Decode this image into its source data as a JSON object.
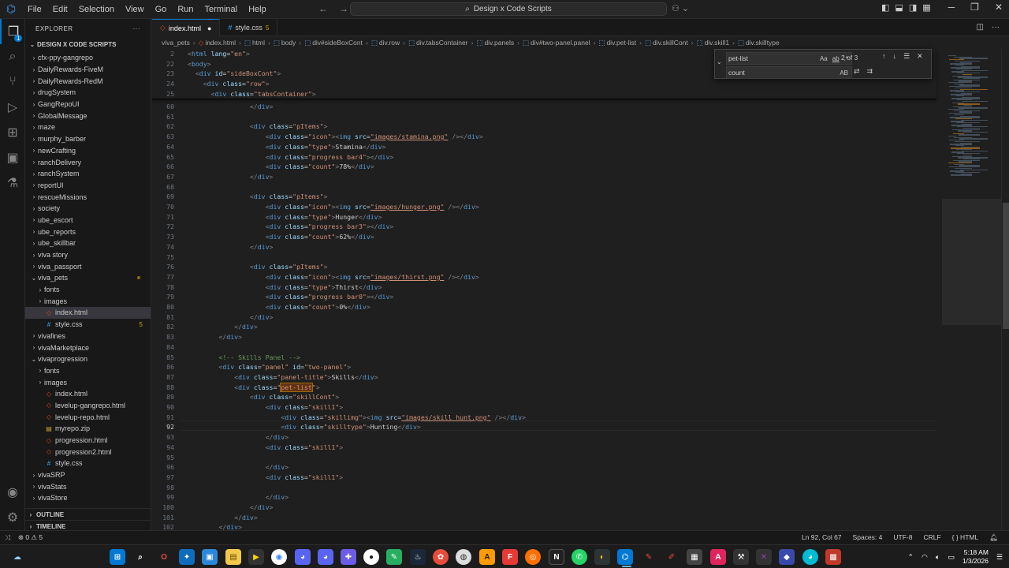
{
  "menu": [
    "File",
    "Edit",
    "Selection",
    "View",
    "Go",
    "Run",
    "Terminal",
    "Help"
  ],
  "command_center": "Design x Code Scripts",
  "explorer": {
    "header": "EXPLORER",
    "project": "DESIGN X CODE SCRIPTS",
    "items": [
      {
        "label": "cfx-ppy-gangrepo",
        "type": "folder",
        "indent": 1
      },
      {
        "label": "DailyRewards-FiveM",
        "type": "folder",
        "indent": 1
      },
      {
        "label": "DailyRewards-RedM",
        "type": "folder",
        "indent": 1
      },
      {
        "label": "drugSystem",
        "type": "folder",
        "indent": 1
      },
      {
        "label": "GangRepoUI",
        "type": "folder",
        "indent": 1
      },
      {
        "label": "GlobalMessage",
        "type": "folder",
        "indent": 1
      },
      {
        "label": "maze",
        "type": "folder",
        "indent": 1
      },
      {
        "label": "murphy_barber",
        "type": "folder",
        "indent": 1
      },
      {
        "label": "newCrafting",
        "type": "folder",
        "indent": 1
      },
      {
        "label": "ranchDelivery",
        "type": "folder",
        "indent": 1
      },
      {
        "label": "ranchSystem",
        "type": "folder",
        "indent": 1
      },
      {
        "label": "reportUI",
        "type": "folder",
        "indent": 1
      },
      {
        "label": "rescueMissions",
        "type": "folder",
        "indent": 1
      },
      {
        "label": "society",
        "type": "folder",
        "indent": 1
      },
      {
        "label": "ube_escort",
        "type": "folder",
        "indent": 1
      },
      {
        "label": "ube_reports",
        "type": "folder",
        "indent": 1
      },
      {
        "label": "ube_skillbar",
        "type": "folder",
        "indent": 1
      },
      {
        "label": "viva story",
        "type": "folder",
        "indent": 1
      },
      {
        "label": "viva_passport",
        "type": "folder",
        "indent": 1
      },
      {
        "label": "viva_pets",
        "type": "folder-open",
        "indent": 1,
        "modified": true
      },
      {
        "label": "fonts",
        "type": "folder",
        "indent": 2
      },
      {
        "label": "images",
        "type": "folder",
        "indent": 2
      },
      {
        "label": "index.html",
        "type": "html",
        "indent": 2,
        "selected": true
      },
      {
        "label": "style.css",
        "type": "css",
        "indent": 2,
        "badge": "5"
      },
      {
        "label": "vivafines",
        "type": "folder",
        "indent": 1
      },
      {
        "label": "vivaMarketplace",
        "type": "folder",
        "indent": 1
      },
      {
        "label": "vivaprogression",
        "type": "folder-open",
        "indent": 1
      },
      {
        "label": "fonts",
        "type": "folder",
        "indent": 2
      },
      {
        "label": "images",
        "type": "folder",
        "indent": 2
      },
      {
        "label": "index.html",
        "type": "html",
        "indent": 2
      },
      {
        "label": "levelup-gangrepo.html",
        "type": "html",
        "indent": 2
      },
      {
        "label": "levelup-repo.html",
        "type": "html",
        "indent": 2
      },
      {
        "label": "myrepo.zip",
        "type": "zip",
        "indent": 2
      },
      {
        "label": "progression.html",
        "type": "html",
        "indent": 2
      },
      {
        "label": "progression2.html",
        "type": "html",
        "indent": 2
      },
      {
        "label": "style.css",
        "type": "css",
        "indent": 2
      },
      {
        "label": "vivaSRP",
        "type": "folder",
        "indent": 1
      },
      {
        "label": "vivaStats",
        "type": "folder",
        "indent": 1
      },
      {
        "label": "vivaStore",
        "type": "folder",
        "indent": 1
      }
    ],
    "outline": "OUTLINE",
    "timeline": "TIMELINE"
  },
  "tabs": [
    {
      "label": "index.html",
      "active": true,
      "modified": true,
      "icon": "html"
    },
    {
      "label": "style.css",
      "active": false,
      "count": "5",
      "icon": "css"
    }
  ],
  "breadcrumb": [
    "viva_pets",
    "index.html",
    "html",
    "body",
    "div#sideBoxCont",
    "div.row",
    "div.tabsContainer",
    "div.panels",
    "div#two-panel.panel",
    "div.pet-list",
    "div.skillCont",
    "div.skill1",
    "div.skilltype"
  ],
  "find_widget": {
    "find_value": "pet-list",
    "replace_value": "count",
    "result_count": "2 of 3",
    "find_opts": [
      "Aa",
      "ab",
      ".*"
    ],
    "replace_opts": [
      "AB"
    ]
  },
  "status": {
    "errors": "0",
    "warnings": "5",
    "position": "Ln 92, Col 67",
    "spaces": "Spaces: 4",
    "encoding": "UTF-8",
    "eol": "CRLF",
    "language": "{ } HTML"
  },
  "clock": {
    "time": "5:18 AM",
    "date": "1/3/2026"
  }
}
